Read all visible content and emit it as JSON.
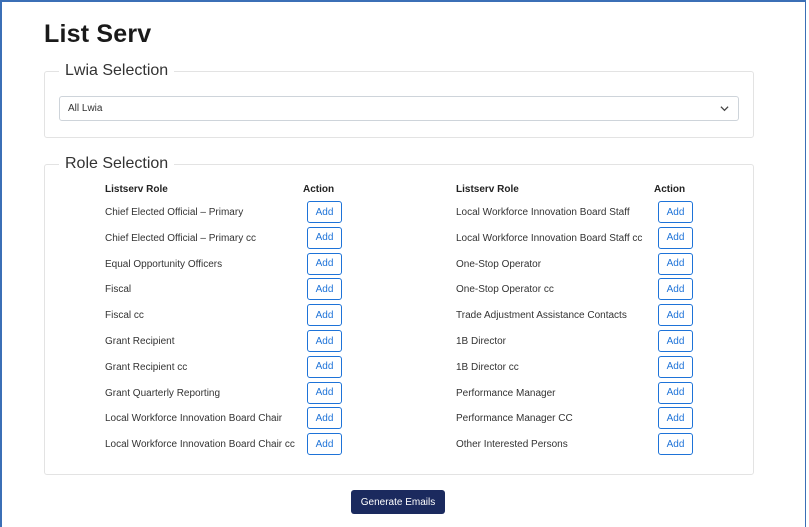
{
  "page": {
    "title": "List Serv"
  },
  "lwia": {
    "legend": "Lwia Selection",
    "selected": "All Lwia",
    "icon": "chevron-down-icon"
  },
  "roles": {
    "legend": "Role Selection",
    "column_header_role": "Listserv Role",
    "column_header_action": "Action",
    "add_label": "Add",
    "left": [
      "Chief Elected Official – Primary",
      "Chief Elected Official – Primary cc",
      "Equal Opportunity Officers",
      "Fiscal",
      "Fiscal cc",
      "Grant Recipient",
      "Grant Recipient cc",
      "Grant Quarterly Reporting",
      "Local Workforce Innovation Board Chair",
      "Local Workforce Innovation Board Chair cc"
    ],
    "right": [
      "Local Workforce Innovation Board Staff",
      "Local Workforce Innovation Board Staff cc",
      "One-Stop Operator",
      "One-Stop Operator cc",
      "Trade Adjustment Assistance Contacts",
      "1B Director",
      "1B Director cc",
      "Performance Manager",
      "Performance Manager CC",
      "Other Interested Persons"
    ]
  },
  "actions": {
    "generate_label": "Generate Emails"
  },
  "colors": {
    "add_button": "#1e73d8",
    "generate_button": "#1b2a5e",
    "window_border": "#3b6fb6"
  }
}
